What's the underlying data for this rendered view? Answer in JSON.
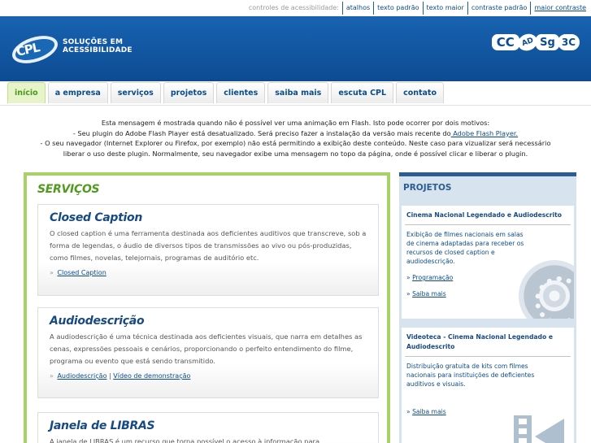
{
  "accessibility": {
    "label": "controles de acessibilidade:",
    "links": [
      "atalhos",
      "texto padrão",
      "texto maior",
      "contraste padrão",
      "maior contraste"
    ]
  },
  "header": {
    "logo_text": "CPL",
    "brand_line1": "SOLUÇÕES EM",
    "brand_line2": "ACESSIBILIDADE",
    "badges": [
      "CC",
      "AD",
      "Sg",
      "3C"
    ]
  },
  "nav": {
    "items": [
      "início",
      "a empresa",
      "serviços",
      "projetos",
      "clientes",
      "saiba mais",
      "escuta CPL",
      "contato"
    ]
  },
  "flash": {
    "line1": "Esta mensagem é mostrada quando não é possível ver uma animação em Flash. Isto pode ocorrer por dois motivos:",
    "line2_pre": "- Seu plugin do Adobe Flash Player está desatualizado. Será preciso fazer a instalação da versão mais recente do",
    "line2_link": " Adobe Flash Player.",
    "line3": "- O seu navegador (Internet Explorer ou Firefox, por exemplo) não está permitindo a exibição deste conteúdo. Neste caso para vizualizar será necessário",
    "line4": "liberar o uso deste plugin. Normalmente, seu navegador exibe uma mensagem no topo da página, onde é possível clicar e liberar o plugin."
  },
  "services": {
    "title": "SERVIÇOS",
    "cards": [
      {
        "title": "Closed Caption",
        "text": "O closed caption é uma ferramenta destinada aos deficientes auditivos que transcreve, sob a forma de legendas, o áudio de diversos tipos de transmissões ao vivo ou pós-produzidas, como filmes, novelas, telejornais, programas de auditório etc.",
        "arrow": "»",
        "link1": "Closed Caption"
      },
      {
        "title": "Audiodescrição",
        "text": "A audiodescrição é uma técnica destinada aos deficientes visuais, que narra em detalhes as cenas, expressões pessoais e cenários, proporcionando o perfeito entendimento do filme, programa ou evento que está sendo transmitido.",
        "arrow": "»",
        "link1": "Audiodescrição",
        "separator": "|",
        "link2": "Vídeo de demonstração"
      },
      {
        "title": "Janela de LIBRAS",
        "text": "A janela de LIBRAS é um recurso que torna possível o acesso à informação para"
      }
    ]
  },
  "projetos": {
    "title": "PROJETOS",
    "cards": [
      {
        "title": "Cinema Nacional Legendado e Audiodescrito",
        "text": "Exibição de filmes nacionais em salas de cinema adaptadas para receber os recursos de closed caption e audiodescrição.",
        "arrow": "»",
        "link1": "Programação",
        "link2": "Saiba mais"
      },
      {
        "title": "Videoteca - Cinema Nacional Legendado e Audiodescrito",
        "text": "Distribuição gratuita de kits com filmes nacionais para instituições de deficientes auditivos e visuais.",
        "arrow": "»",
        "link1": "Saiba mais"
      }
    ]
  }
}
